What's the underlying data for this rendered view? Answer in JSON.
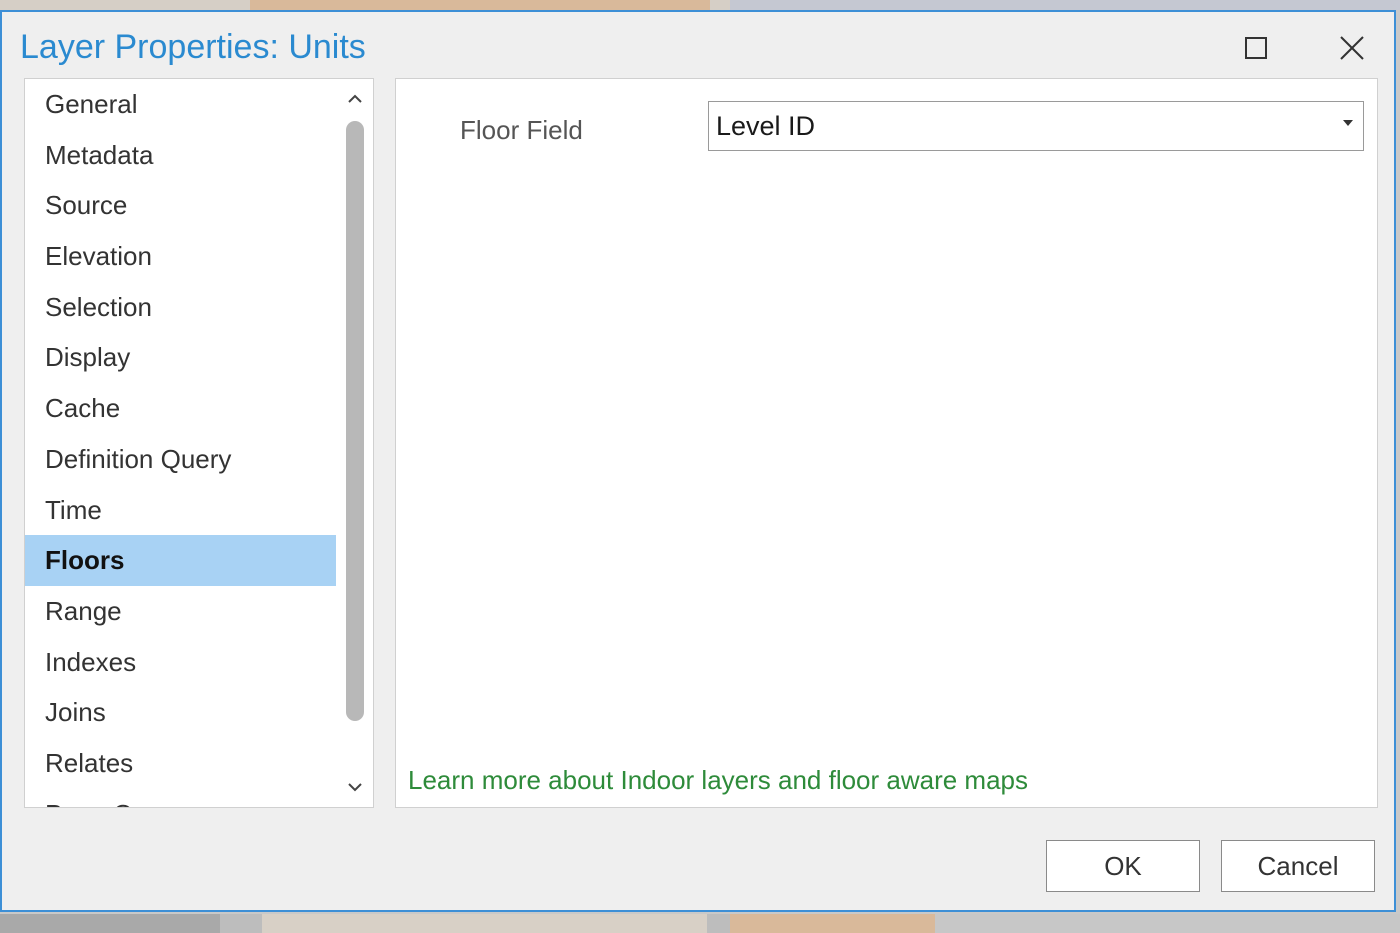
{
  "window": {
    "title": "Layer Properties: Units",
    "maximize_icon": "maximize-icon",
    "close_icon": "close-icon"
  },
  "sidebar": {
    "items": [
      {
        "label": "General"
      },
      {
        "label": "Metadata"
      },
      {
        "label": "Source"
      },
      {
        "label": "Elevation"
      },
      {
        "label": "Selection"
      },
      {
        "label": "Display"
      },
      {
        "label": "Cache"
      },
      {
        "label": "Definition Query"
      },
      {
        "label": "Time"
      },
      {
        "label": "Floors",
        "selected": true
      },
      {
        "label": "Range"
      },
      {
        "label": "Indexes"
      },
      {
        "label": "Joins"
      },
      {
        "label": "Relates"
      },
      {
        "label": "Page Query"
      }
    ]
  },
  "floors": {
    "field_label": "Floor Field",
    "field_value": "Level ID",
    "learn_more_link": "Learn more about Indoor layers and floor aware maps"
  },
  "footer": {
    "ok_label": "OK",
    "cancel_label": "Cancel"
  },
  "colors": {
    "title": "#2a8ad0",
    "accent_border": "#3d8fd6",
    "selected_item_bg": "#a8d2f4",
    "link": "#2e8b3a"
  }
}
